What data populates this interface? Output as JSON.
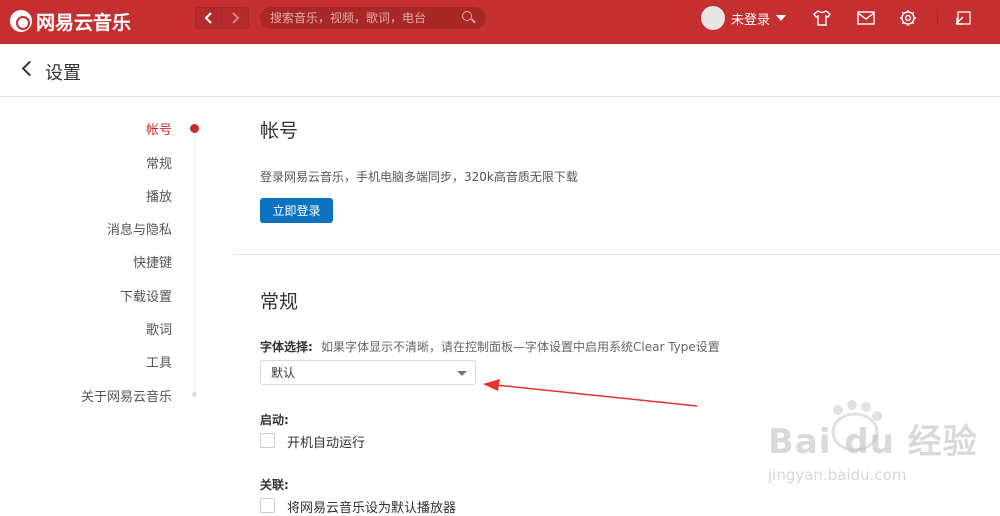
{
  "app": {
    "logo_text": "网易云音乐"
  },
  "topbar": {
    "search_placeholder": "搜索音乐，视频，歌词，电台",
    "user_label": "未登录",
    "icons": [
      "skin-icon",
      "mail-icon",
      "gear-icon",
      "mini-mode-icon"
    ]
  },
  "header": {
    "title": "设置"
  },
  "side_nav": {
    "items": [
      {
        "label": "帐号",
        "active": true
      },
      {
        "label": "常规"
      },
      {
        "label": "播放"
      },
      {
        "label": "消息与隐私"
      },
      {
        "label": "快捷键"
      },
      {
        "label": "下载设置"
      },
      {
        "label": "歌词"
      },
      {
        "label": "工具"
      },
      {
        "label": "关于网易云音乐"
      }
    ]
  },
  "account": {
    "title": "帐号",
    "description": "登录网易云音乐，手机电脑多端同步，320k高音质无限下载",
    "login_button": "立即登录"
  },
  "general": {
    "title": "常规",
    "font_label": "字体选择:",
    "font_hint": "如果字体显示不清晰，请在控制面板—字体设置中启用系统Clear Type设置",
    "font_value": "默认",
    "startup_label": "启动:",
    "startup_option": "开机自动运行",
    "assoc_label": "关联:",
    "assoc_option": "将网易云音乐设为默认播放器"
  },
  "watermark": {
    "brand": "Bai du 经验",
    "url": "jingyan.baidu.com"
  },
  "colors": {
    "brand_red": "#c62f2f",
    "button_blue": "#0c73c2",
    "annotation_red": "#e8302f"
  }
}
